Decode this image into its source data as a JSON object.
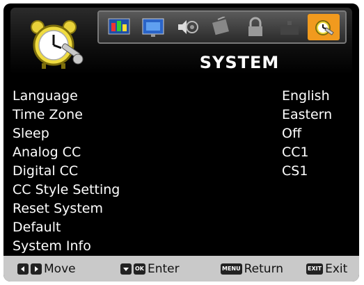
{
  "header": {
    "title": "SYSTEM",
    "tabs": [
      {
        "icon": "picture-icon"
      },
      {
        "icon": "screen-icon"
      },
      {
        "icon": "audio-icon"
      },
      {
        "icon": "channel-icon"
      },
      {
        "icon": "lock-icon"
      },
      {
        "icon": "option-icon"
      },
      {
        "icon": "system-icon",
        "active": true
      }
    ],
    "active_color": "#f19a1e"
  },
  "menu": [
    {
      "label": "Language",
      "value": "English"
    },
    {
      "label": "Time Zone",
      "value": "Eastern"
    },
    {
      "label": "Sleep",
      "value": "Off"
    },
    {
      "label": "Analog CC",
      "value": "CC1"
    },
    {
      "label": "Digital CC",
      "value": "CS1"
    },
    {
      "label": "CC Style Setting",
      "value": ""
    },
    {
      "label": "Reset System",
      "value": ""
    },
    {
      "label": "Default",
      "value": ""
    },
    {
      "label": "System Info",
      "value": ""
    }
  ],
  "footer": {
    "move": "Move",
    "enter_key": "OK",
    "enter": "Enter",
    "return_key": "MENU",
    "return": "Return",
    "exit_key": "EXIT",
    "exit": "Exit"
  }
}
